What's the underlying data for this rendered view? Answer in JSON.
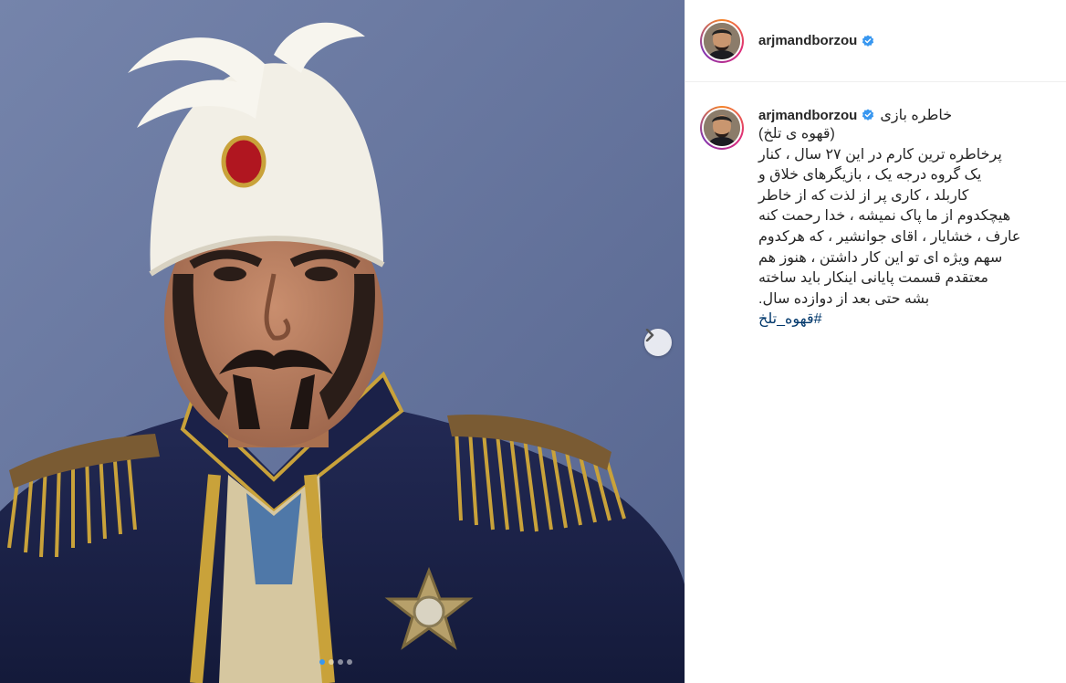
{
  "post": {
    "username": "arjmandborzou",
    "verified": true,
    "caption_first": "خاطره بازی",
    "caption_lines": [
      "(قهوه ی تلخ)",
      "پرخاطره ترین کارم در این ۲۷ سال ، کنار",
      "یک گروه درجه یک ، بازیگرهای خلاق و",
      "کاربلد ، کاری پر از لذت که از خاطر",
      "هیچکدوم از ما پاک نمیشه ، خدا رحمت کنه",
      "عارف ، خشایار ، اقای جوانشیر ، که هرکدوم",
      "سهم ویژه ای تو این کار داشتن ، هنوز هم",
      "معتقدم قسمت پایانی اینکار باید ساخته",
      "بشه حتی بعد از دوازده سال."
    ],
    "hashtag": "#قهوه_تلخ"
  },
  "media": {
    "carousel_count": 4,
    "active_index": 0,
    "next_icon": "chevron-right-icon"
  },
  "colors": {
    "accent": "#3897f0",
    "hashtag": "#00376b"
  }
}
